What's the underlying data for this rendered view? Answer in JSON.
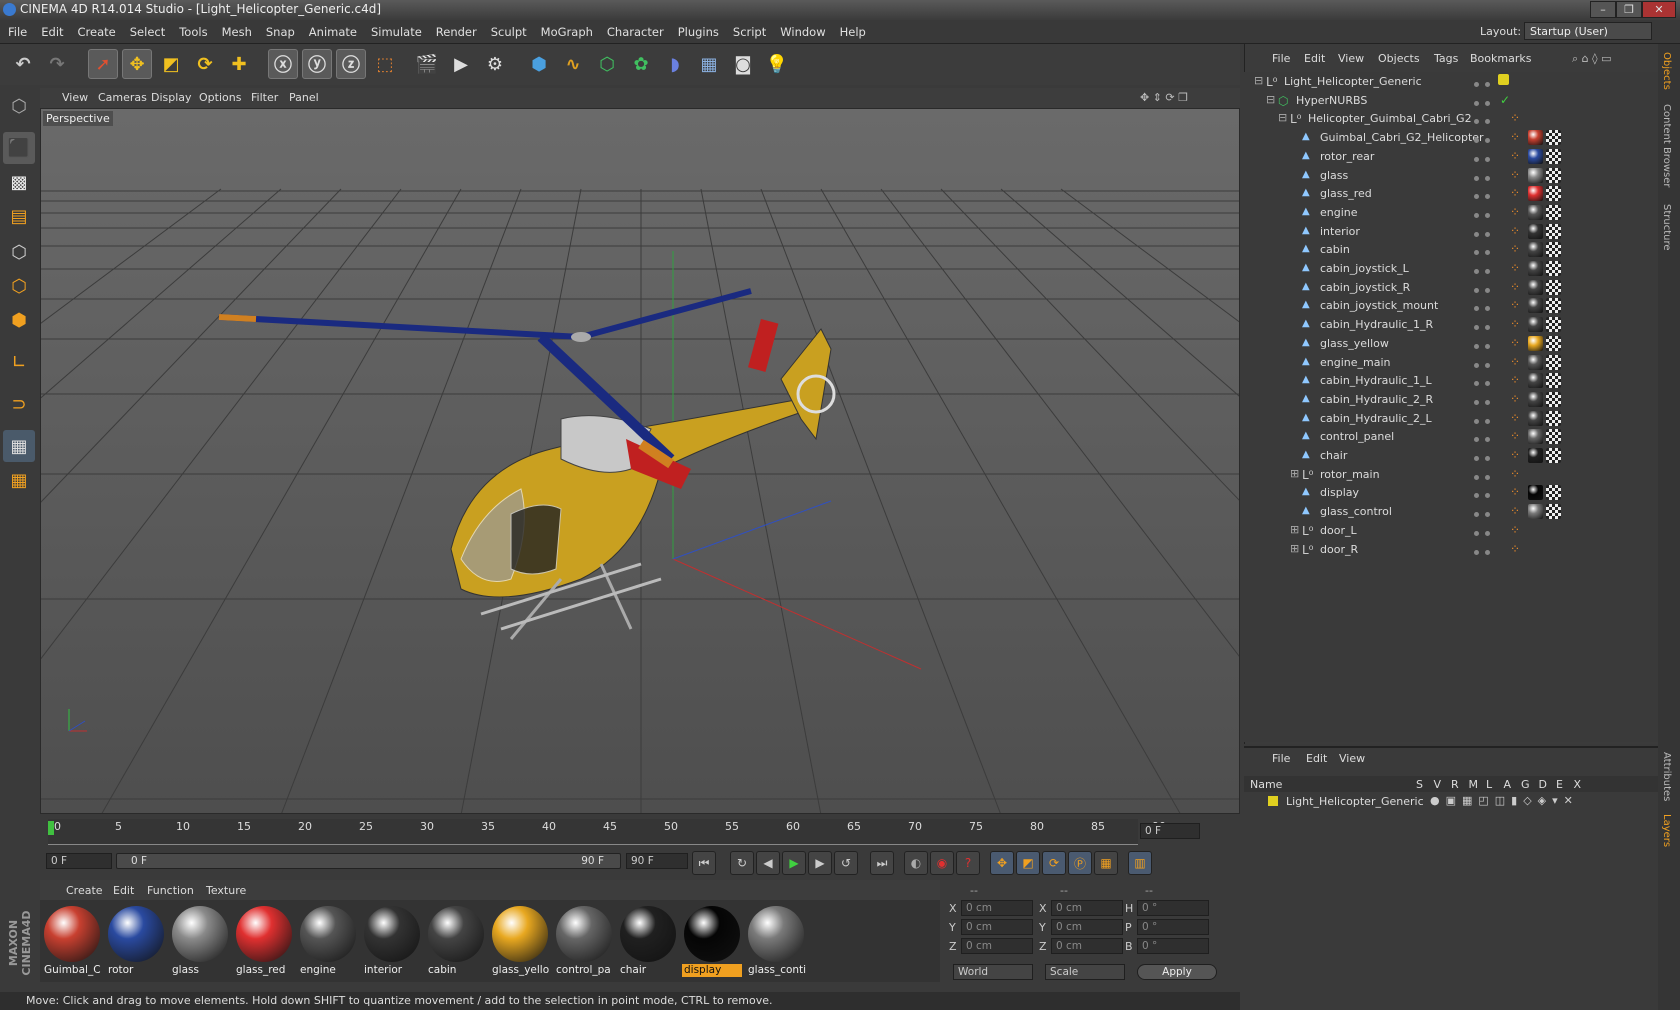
{
  "window": {
    "title": "CINEMA 4D R14.014 Studio - [Light_Helicopter_Generic.c4d]",
    "min": "–",
    "max": "❐",
    "close": "✕"
  },
  "menubar": [
    "File",
    "Edit",
    "Create",
    "Select",
    "Tools",
    "Mesh",
    "Snap",
    "Animate",
    "Simulate",
    "Render",
    "Sculpt",
    "MoGraph",
    "Character",
    "Plugins",
    "Script",
    "Window",
    "Help"
  ],
  "layout": {
    "label": "Layout:",
    "value": "Startup (User)"
  },
  "viewport": {
    "menu": [
      "View",
      "Cameras",
      "Display",
      "Options",
      "Filter",
      "Panel"
    ],
    "label": "Perspective"
  },
  "timeline": {
    "ticks": [
      "0",
      "5",
      "10",
      "15",
      "20",
      "25",
      "30",
      "35",
      "40",
      "45",
      "50",
      "55",
      "60",
      "65",
      "70",
      "75",
      "80",
      "85",
      "90"
    ],
    "frame_field": "0 F"
  },
  "transport": {
    "start": "0 F",
    "range_start": "0 F",
    "range_end": "90 F",
    "end": "90 F"
  },
  "materials": {
    "menu": [
      "Create",
      "Edit",
      "Function",
      "Texture"
    ],
    "items": [
      {
        "label": "Guimbal_C",
        "color": "#c84030"
      },
      {
        "label": "rotor",
        "color": "#2a4aa0"
      },
      {
        "label": "glass",
        "color": "#8a8a8a"
      },
      {
        "label": "glass_red",
        "color": "#e03030"
      },
      {
        "label": "engine",
        "color": "#555555"
      },
      {
        "label": "interior",
        "color": "#333333"
      },
      {
        "label": "cabin",
        "color": "#444444"
      },
      {
        "label": "glass_yello",
        "color": "#e8a820"
      },
      {
        "label": "control_pa",
        "color": "#666666"
      },
      {
        "label": "chair",
        "color": "#202020"
      },
      {
        "label": "display",
        "color": "#050505"
      },
      {
        "label": "glass_conti",
        "color": "#7a7a7a"
      }
    ]
  },
  "coords": {
    "head": [
      "--",
      "--",
      "--"
    ],
    "rows": [
      {
        "a": "X",
        "av": "0 cm",
        "b": "X",
        "bv": "0 cm",
        "c": "H",
        "cv": "0 °"
      },
      {
        "a": "Y",
        "av": "0 cm",
        "b": "Y",
        "bv": "0 cm",
        "c": "P",
        "cv": "0 °"
      },
      {
        "a": "Z",
        "av": "0 cm",
        "b": "Z",
        "bv": "0 cm",
        "c": "B",
        "cv": "0 °"
      }
    ],
    "world": "World",
    "scale": "Scale",
    "apply": "Apply"
  },
  "status": "Move: Click and drag to move elements. Hold down SHIFT to quantize movement / add to the selection in point mode, CTRL to remove.",
  "brand": "MAXON CINEMA4D",
  "objects": {
    "menu": [
      "File",
      "Edit",
      "View",
      "Objects",
      "Tags",
      "Bookmarks"
    ],
    "items": [
      {
        "name": "Light_Helicopter_Generic",
        "level": 0,
        "type": "null"
      },
      {
        "name": "HyperNURBS",
        "level": 1,
        "type": "nurbs"
      },
      {
        "name": "Helicopter_Guimbal_Cabri_G2",
        "level": 2,
        "type": "null"
      },
      {
        "name": "Guimbal_Cabri_G2_Helicopter",
        "level": 3,
        "type": "poly",
        "tag": "#c84030"
      },
      {
        "name": "rotor_rear",
        "level": 3,
        "type": "poly",
        "tag": "#2a4aa0"
      },
      {
        "name": "glass",
        "level": 3,
        "type": "poly",
        "tag": "#8a8a8a"
      },
      {
        "name": "glass_red",
        "level": 3,
        "type": "poly",
        "tag": "#e03030"
      },
      {
        "name": "engine",
        "level": 3,
        "type": "poly",
        "tag": "#555555"
      },
      {
        "name": "interior",
        "level": 3,
        "type": "poly",
        "tag": "#333333"
      },
      {
        "name": "cabin",
        "level": 3,
        "type": "poly",
        "tag": "#444444"
      },
      {
        "name": "cabin_joystick_L",
        "level": 3,
        "type": "poly",
        "tag": "#444444"
      },
      {
        "name": "cabin_joystick_R",
        "level": 3,
        "type": "poly",
        "tag": "#444444"
      },
      {
        "name": "cabin_joystick_mount",
        "level": 3,
        "type": "poly",
        "tag": "#444444"
      },
      {
        "name": "cabin_Hydraulic_1_R",
        "level": 3,
        "type": "poly",
        "tag": "#444444"
      },
      {
        "name": "glass_yellow",
        "level": 3,
        "type": "poly",
        "tag": "#e8a820"
      },
      {
        "name": "engine_main",
        "level": 3,
        "type": "poly",
        "tag": "#555555"
      },
      {
        "name": "cabin_Hydraulic_1_L",
        "level": 3,
        "type": "poly",
        "tag": "#444444"
      },
      {
        "name": "cabin_Hydraulic_2_R",
        "level": 3,
        "type": "poly",
        "tag": "#444444"
      },
      {
        "name": "cabin_Hydraulic_2_L",
        "level": 3,
        "type": "poly",
        "tag": "#444444"
      },
      {
        "name": "control_panel",
        "level": 3,
        "type": "poly",
        "tag": "#666666"
      },
      {
        "name": "chair",
        "level": 3,
        "type": "poly",
        "tag": "#202020"
      },
      {
        "name": "rotor_main",
        "level": 3,
        "type": "null"
      },
      {
        "name": "display",
        "level": 3,
        "type": "poly",
        "tag": "#050505"
      },
      {
        "name": "glass_control",
        "level": 3,
        "type": "poly",
        "tag": "#7a7a7a"
      },
      {
        "name": "door_L",
        "level": 3,
        "type": "null"
      },
      {
        "name": "door_R",
        "level": 3,
        "type": "null"
      }
    ]
  },
  "attributes": {
    "menu": [
      "File",
      "Edit",
      "View"
    ],
    "cols": [
      "Name",
      "S",
      "V",
      "R",
      "M",
      "L",
      "A",
      "G",
      "D",
      "E",
      "X"
    ],
    "layer": "Light_Helicopter_Generic"
  },
  "sidetabs": [
    "Objects",
    "Content Browser",
    "Structure",
    "Attributes",
    "Layers"
  ]
}
